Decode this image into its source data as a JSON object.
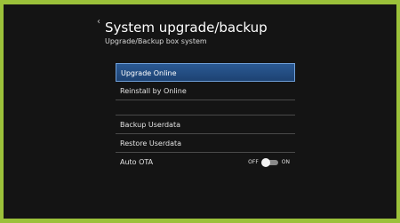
{
  "header": {
    "back_glyph": "‹",
    "title": "System upgrade/backup",
    "subtitle": "Upgrade/Backup box system"
  },
  "menu": {
    "upgrade_online": "Upgrade Online",
    "reinstall_online": "Reinstall by Online",
    "backup_userdata": "Backup Userdata",
    "restore_userdata": "Restore Userdata",
    "auto_ota": "Auto OTA"
  },
  "auto_ota_toggle": {
    "off_label": "OFF",
    "on_label": "ON",
    "state": "OFF"
  },
  "colors": {
    "frame": "#9bc13a",
    "background": "#141414",
    "selection": "#1d4272",
    "selection_border": "#6f9fd8"
  }
}
